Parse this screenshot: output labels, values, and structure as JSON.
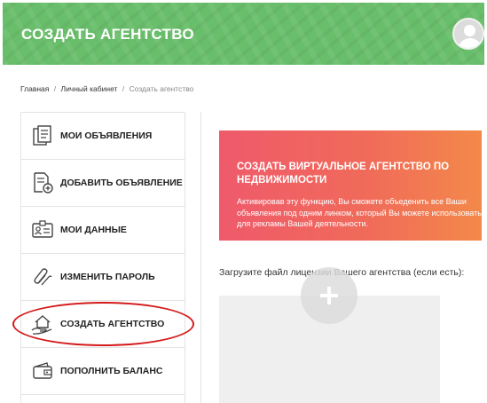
{
  "header": {
    "title": "СОЗДАТЬ АГЕНТСТВО",
    "avatar_icon": "user-avatar-icon"
  },
  "breadcrumb": {
    "items": [
      "Главная",
      "Личный кабинет",
      "Создать агентство"
    ],
    "separator": "/"
  },
  "sidebar": {
    "items": [
      {
        "label": "МОИ ОБЪЯВЛЕНИЯ",
        "icon": "documents-icon"
      },
      {
        "label": "ДОБАВИТЬ ОБЪЯВЛЕНИЕ",
        "icon": "add-document-icon"
      },
      {
        "label": "МОИ ДАННЫЕ",
        "icon": "id-card-icon"
      },
      {
        "label": "ИЗМЕНИТЬ ПАРОЛЬ",
        "icon": "paperclip-icon"
      },
      {
        "label": "СОЗДАТЬ АГЕНТСТВО",
        "icon": "house-hand-icon"
      },
      {
        "label": "ПОПОЛНИТЬ БАЛАНС",
        "icon": "wallet-icon"
      }
    ]
  },
  "promo": {
    "title": "СОЗДАТЬ ВИРТУАЛЬНОЕ АГЕНТСТВО ПО НЕДВИЖИМОСТИ",
    "text": "Активировав эту функцию, Вы сможете объеденить все Ваши объявления под одним линком, который Вы можете использовать для рекламы Вашей деятельности."
  },
  "upload": {
    "label": "Загрузите файл лицензии Вашего агентства (если есть):",
    "button_icon": "plus-icon"
  },
  "colors": {
    "header_green": "#69be6b",
    "promo_start": "#ef5a6b",
    "promo_end": "#f3894a",
    "annotation_red": "#d41a1a"
  }
}
